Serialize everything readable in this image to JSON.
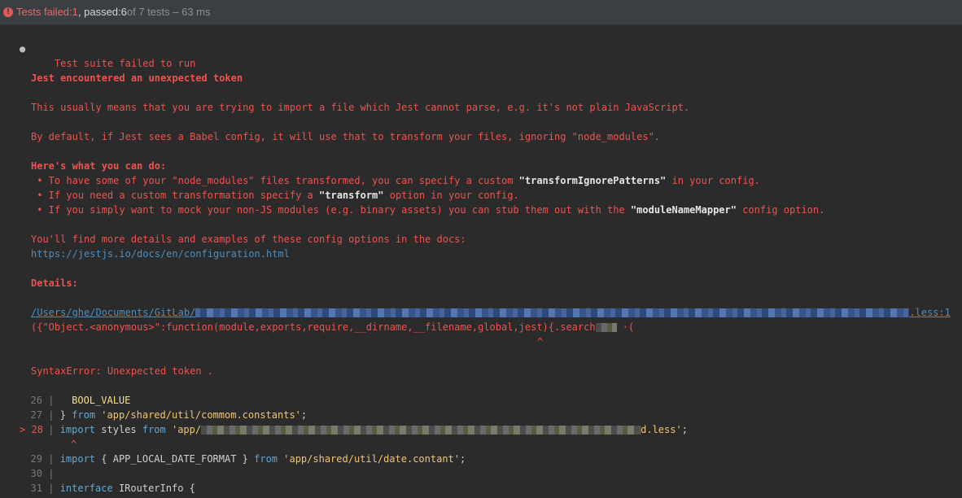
{
  "status": {
    "failed_label": "Tests failed: ",
    "failed_count": "1",
    "passed_label": ", passed: ",
    "passed_count": "6",
    "total": " of 7 tests – 63 ms"
  },
  "output": {
    "suite_title": "Test suite failed to run",
    "heading": "Jest encountered an unexpected token",
    "line1": "This usually means that you are trying to import a file which Jest cannot parse, e.g. it's not plain JavaScript.",
    "line2": "By default, if Jest sees a Babel config, it will use that to transform your files, ignoring \"node_modules\".",
    "todo_heading": "Here's what you can do:",
    "tip1_a": " • To have some of your \"node_modules\" files transformed, you can specify a custom ",
    "tip1_b": "\"transformIgnorePatterns\"",
    "tip1_c": " in your config.",
    "tip2_a": " • If you need a custom transformation specify a ",
    "tip2_b": "\"transform\"",
    "tip2_c": " option in your config.",
    "tip3_a": " • If you simply want to mock your non-JS modules (e.g. binary assets) you can stub them out with the ",
    "tip3_b": "\"moduleNameMapper\"",
    "tip3_c": " config option.",
    "more_details": "You'll find more details and examples of these config options in the docs:",
    "docs_link": "https://jestjs.io/docs/en/configuration.html",
    "details_label": "Details:",
    "path_prefix": "/Users/ghe/Documents/GitLab/",
    "path_suffix": ".less:1",
    "anon_fn": "({\"Object.<anonymous>\":function(module,exports,require,__dirname,__filename,global,jest){.search",
    "caret": "^",
    "syntax_error": "SyntaxError: Unexpected token ."
  },
  "code": [
    {
      "num": "26",
      "marker": "",
      "text": "  BOOL_VALUE"
    },
    {
      "num": "27",
      "marker": "",
      "prefix": "} ",
      "kw": "from",
      "str": " 'app/shared/util/commom.constants'",
      "tail": ";"
    },
    {
      "num": "28",
      "marker": ">",
      "kw": "import",
      "mid": " styles ",
      "kw2": "from",
      "str": " 'app/",
      "str_end": "d.less'",
      "tail": ";"
    },
    {
      "num": "29",
      "marker": "",
      "kw": "import",
      "mid": " { APP_LOCAL_DATE_FORMAT } ",
      "kw2": "from",
      "str": " 'app/shared/util/date.contant'",
      "tail": ";"
    },
    {
      "num": "30",
      "marker": "",
      "text": ""
    },
    {
      "num": "31",
      "marker": "",
      "kw": "interface",
      "mid": " IRouterInfo {"
    }
  ],
  "colors": {
    "error": "#f0524f",
    "link": "#4a8fc4",
    "background": "#2b2b2b"
  }
}
